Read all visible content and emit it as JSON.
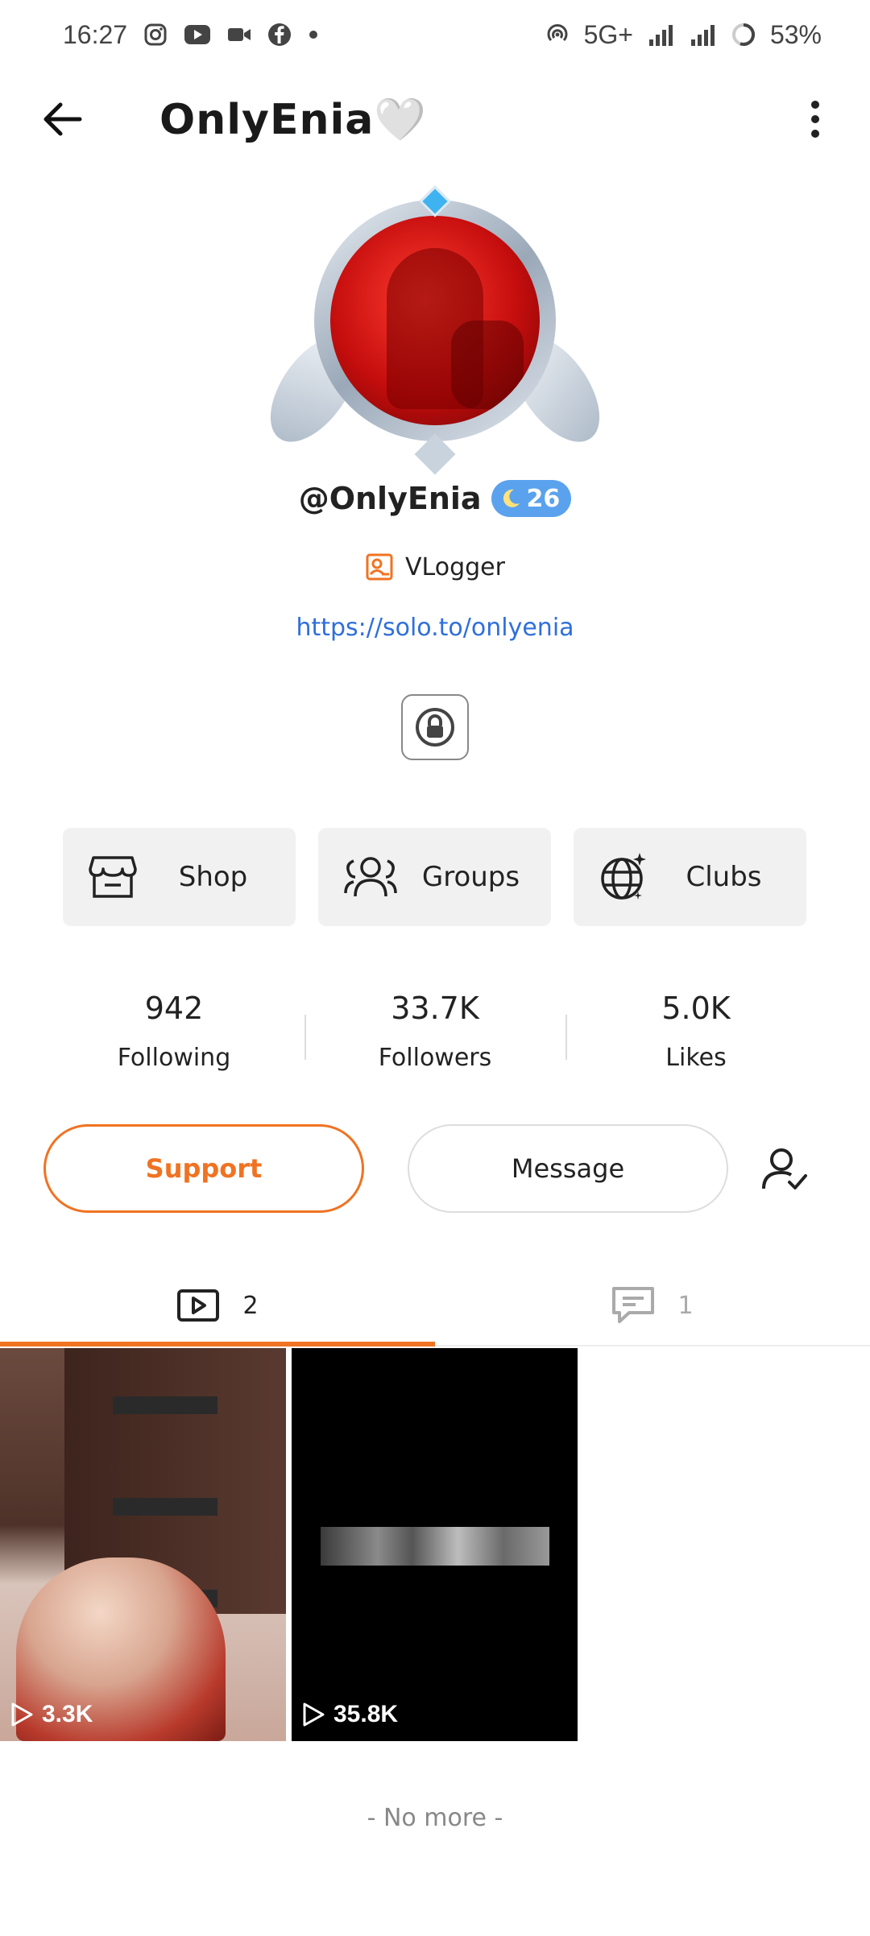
{
  "status_bar": {
    "time": "16:27",
    "network": "5G+",
    "battery": "53%",
    "app_icons": [
      "instagram-icon",
      "youtube-icon",
      "video-call-icon",
      "facebook-icon",
      "dot-icon"
    ]
  },
  "header": {
    "title": "OnlyEnia🤍"
  },
  "profile": {
    "handle": "@OnlyEnia",
    "level": "26",
    "role": "VLogger",
    "link": "https://solo.to/onlyenia"
  },
  "features": [
    {
      "label": "Shop",
      "icon": "store-icon"
    },
    {
      "label": "Groups",
      "icon": "people-icon"
    },
    {
      "label": "Clubs",
      "icon": "globe-icon"
    }
  ],
  "stats": [
    {
      "value": "942",
      "label": "Following"
    },
    {
      "value": "33.7K",
      "label": "Followers"
    },
    {
      "value": "5.0K",
      "label": "Likes"
    }
  ],
  "actions": {
    "support_label": "Support",
    "message_label": "Message"
  },
  "tabs": [
    {
      "count": "2",
      "icon": "video-icon",
      "active": true
    },
    {
      "count": "1",
      "icon": "comment-icon",
      "active": false
    }
  ],
  "videos": [
    {
      "views": "3.3K"
    },
    {
      "views": "35.8K"
    }
  ],
  "footer": {
    "no_more": "- No more -"
  },
  "colors": {
    "accent": "#f07322",
    "link": "#2f6fdc",
    "badge": "#5aa2ee"
  }
}
